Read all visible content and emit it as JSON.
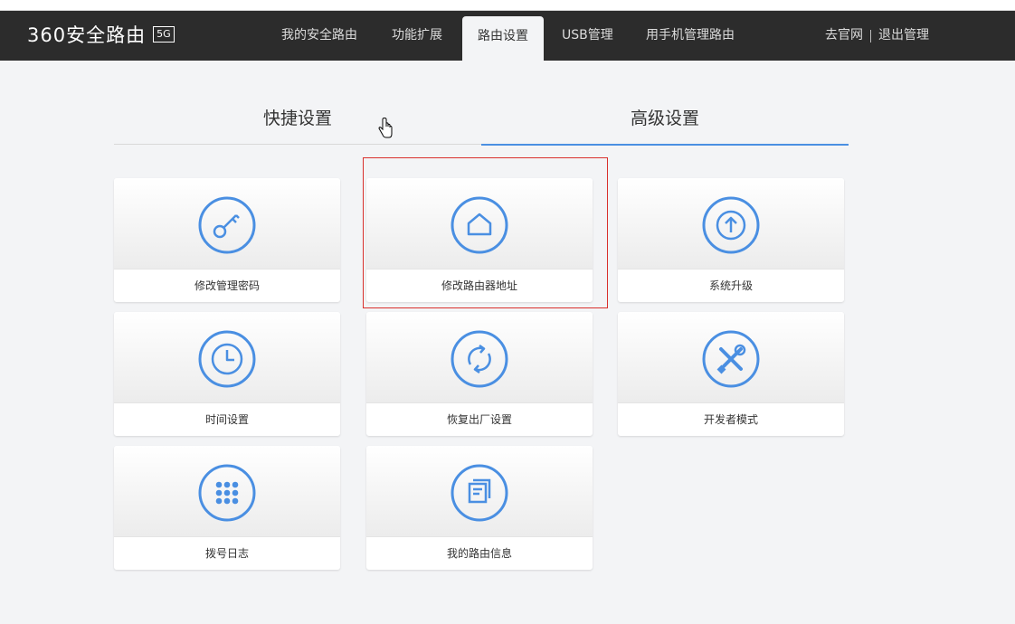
{
  "navbar": {
    "brand": "360安全路由",
    "badge": "5G",
    "items": [
      {
        "label": "我的安全路由"
      },
      {
        "label": "功能扩展"
      },
      {
        "label": "路由设置"
      },
      {
        "label": "USB管理"
      },
      {
        "label": "用手机管理路由"
      }
    ],
    "active_item": "路由设置",
    "right": {
      "website": "去官网",
      "logout": "退出管理"
    }
  },
  "tabs": {
    "quick": "快捷设置",
    "advanced": "高级设置",
    "active": "高级设置"
  },
  "tiles": [
    {
      "label": "修改管理密码",
      "icon": "key-icon"
    },
    {
      "label": "修改路由器地址",
      "icon": "home-icon",
      "highlighted": true
    },
    {
      "label": "系统升级",
      "icon": "upgrade-icon"
    },
    {
      "label": "时间设置",
      "icon": "clock-icon"
    },
    {
      "label": "恢复出厂设置",
      "icon": "restore-icon"
    },
    {
      "label": "开发者模式",
      "icon": "tools-icon"
    },
    {
      "label": "拨号日志",
      "icon": "dialpad-icon"
    },
    {
      "label": "我的路由信息",
      "icon": "info-document-icon"
    }
  ],
  "colors": {
    "accent": "#4a8fe2",
    "navbar_bg": "#2c2c2c",
    "page_bg": "#f3f4f6",
    "highlight_border": "#d9302c"
  }
}
